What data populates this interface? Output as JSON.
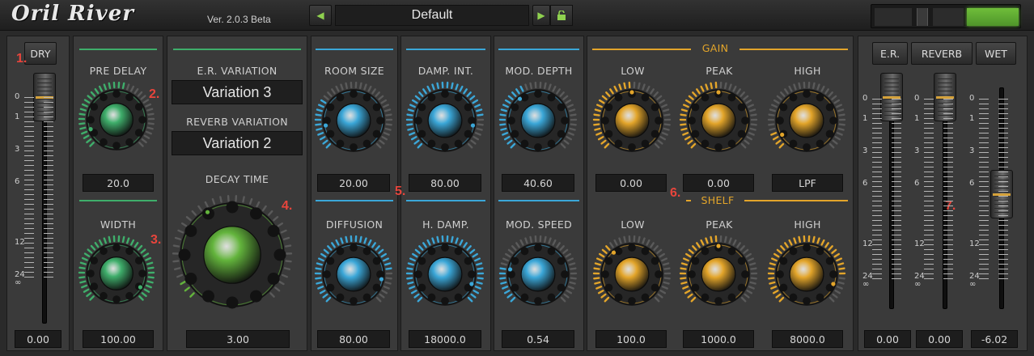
{
  "app": {
    "title": "Oril River",
    "version": "Ver. 2.0.3 Beta"
  },
  "toolbar": {
    "preset": "Default",
    "prev_icon": "left-triangle",
    "next_icon": "right-triangle",
    "lock_icon": "lock"
  },
  "colors": {
    "green": "#3fae6b",
    "blue": "#3ba7d8",
    "gold": "#e3a52a",
    "accent_red": "#e8453c"
  },
  "dry": {
    "button": "DRY",
    "value": "0.00",
    "marker": "1."
  },
  "predelay": {
    "label": "PRE DELAY",
    "value": "20.0",
    "marker": "2."
  },
  "width": {
    "label": "WIDTH",
    "value": "100.00",
    "marker": "3."
  },
  "variation": {
    "er_label": "E.R. VARIATION",
    "er_value": "Variation 3",
    "rev_label": "REVERB VARIATION",
    "rev_value": "Variation 2"
  },
  "decay": {
    "label": "DECAY TIME",
    "value": "3.00",
    "marker": "4."
  },
  "reverb": {
    "marker": "5.",
    "room_size": {
      "label": "ROOM SIZE",
      "value": "20.00"
    },
    "damp_int": {
      "label": "DAMP. INT.",
      "value": "80.00"
    },
    "mod_depth": {
      "label": "MOD. DEPTH",
      "value": "40.60"
    },
    "diffusion": {
      "label": "DIFFUSION",
      "value": "80.00"
    },
    "h_damp": {
      "label": "H. DAMP.",
      "value": "18000.0"
    },
    "mod_speed": {
      "label": "MOD. SPEED",
      "value": "0.54"
    }
  },
  "eq": {
    "marker": "6.",
    "gain_title": "GAIN",
    "shelf_title": "SHELF",
    "gain": [
      {
        "label": "LOW",
        "value": "0.00"
      },
      {
        "label": "PEAK",
        "value": "0.00"
      },
      {
        "label": "HIGH",
        "value": "LPF"
      }
    ],
    "shelf": [
      {
        "label": "LOW",
        "value": "100.0"
      },
      {
        "label": "PEAK",
        "value": "1000.0"
      },
      {
        "label": "HIGH",
        "value": "8000.0"
      }
    ]
  },
  "mix": {
    "marker": "7.",
    "er": {
      "button": "E.R.",
      "value": "0.00"
    },
    "reverb": {
      "button": "REVERB",
      "value": "0.00"
    },
    "wet": {
      "button": "WET",
      "value": "-6.02"
    },
    "scale": [
      "0",
      "1",
      "3",
      "6",
      "12",
      "24",
      "∞"
    ]
  }
}
